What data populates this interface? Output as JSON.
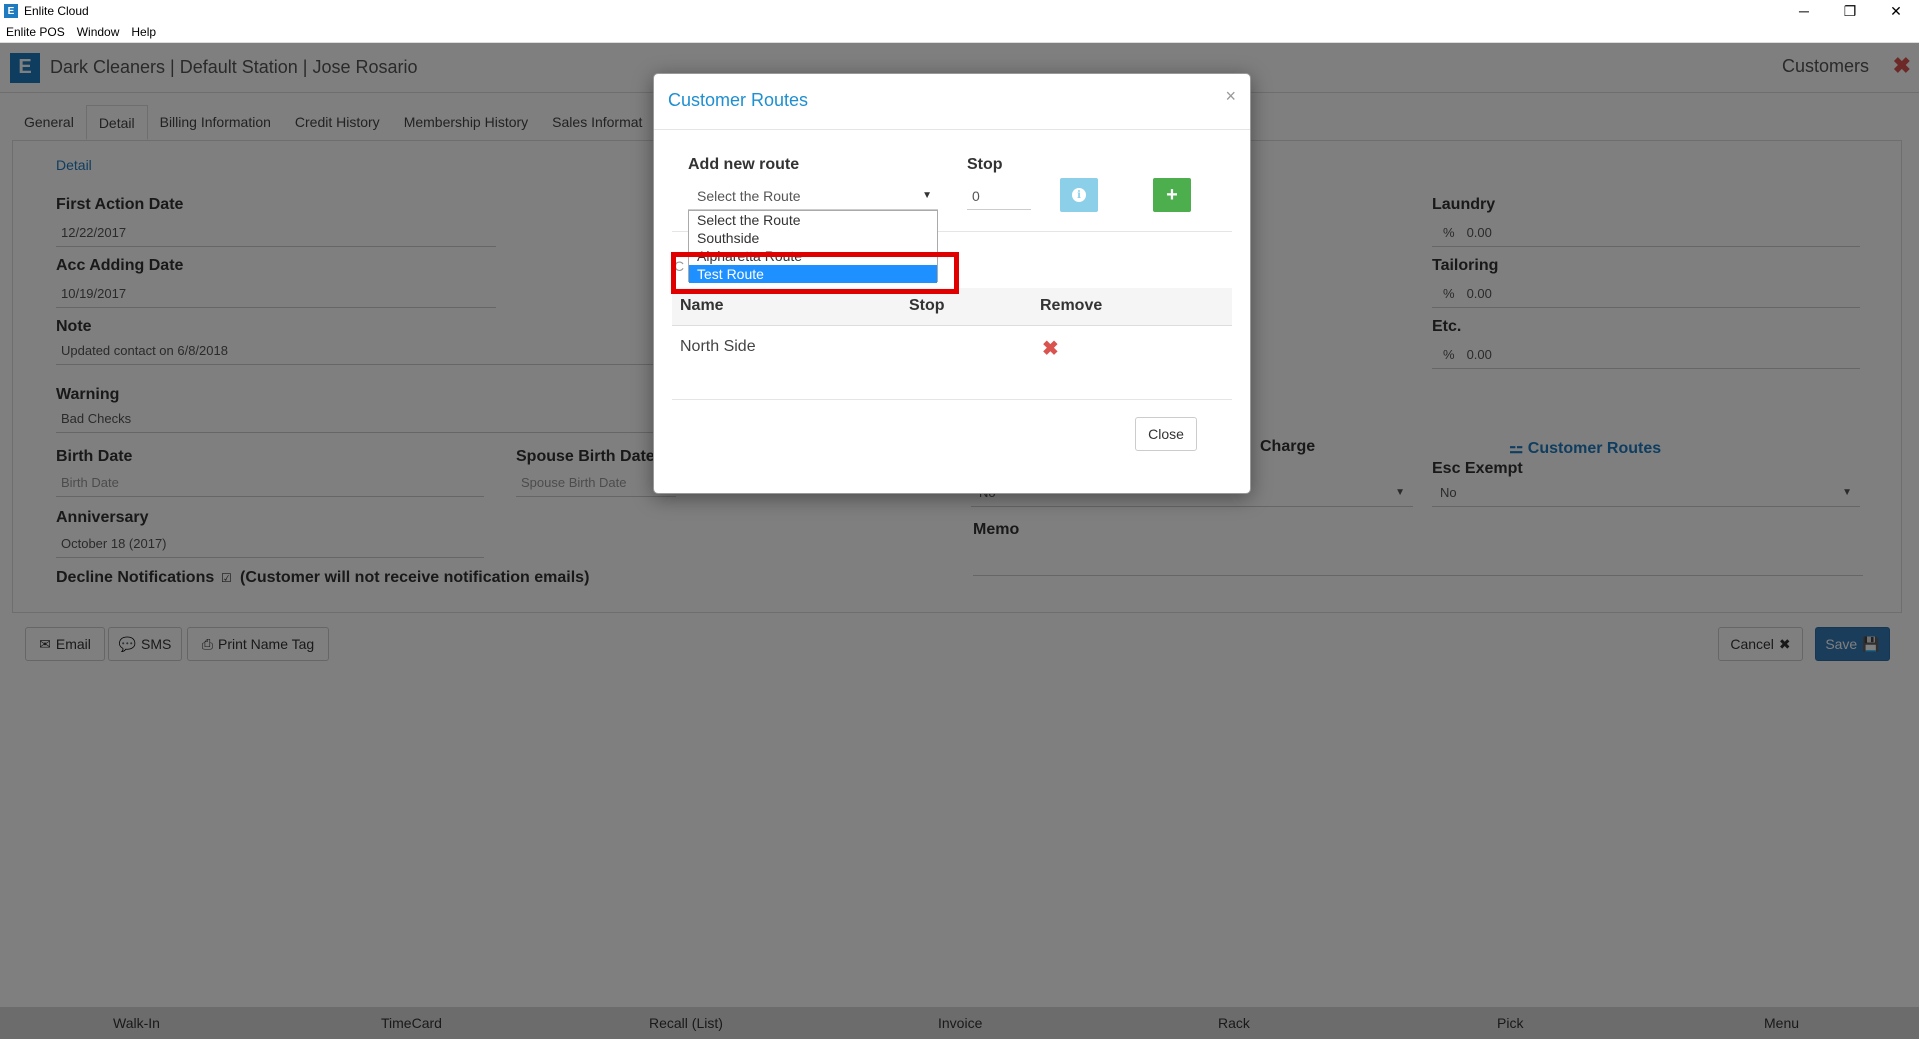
{
  "window": {
    "title": "Enlite Cloud",
    "controls": {
      "minimize": "─",
      "restore": "❐",
      "close": "✕"
    }
  },
  "menu": [
    "Enlite POS",
    "Window",
    "Help"
  ],
  "header": {
    "title": "Dark Cleaners | Default Station | Jose Rosario",
    "section": "Customers",
    "close": "✖"
  },
  "tabs": [
    "General",
    "Detail",
    "Billing Information",
    "Credit History",
    "Membership History",
    "Sales Informat"
  ],
  "detail": {
    "sub_link": "Detail",
    "first_action_label": "First Action Date",
    "first_action_value": "12/22/2017",
    "acc_adding_label": "Acc Adding Date",
    "acc_adding_value": "10/19/2017",
    "note_label": "Note",
    "note_value": "Updated contact on 6/8/2018",
    "warning_label": "Warning",
    "warning_value": "Bad Checks",
    "birth_label": "Birth Date",
    "birth_placeholder": "Birth Date",
    "spouse_label": "Spouse Birth Date",
    "spouse_placeholder": "Spouse Birth Date",
    "anniversary_label": "Anniversary",
    "anniversary_value": "October 18 (2017)",
    "decline_label": "Decline Notifications",
    "decline_note": "(Customer will not receive notification emails)",
    "laundry_label": "Laundry",
    "tailoring_label": "Tailoring",
    "etc_label": "Etc.",
    "percent": "%",
    "laundry_value": "0.00",
    "tailoring_value": "0.00",
    "etc_value": "0.00",
    "charge_label": "Charge",
    "customer_routes_link": "Customer Routes",
    "esc_exempt_label": "Esc Exempt",
    "charge_value": "No",
    "esc_exempt_value": "No",
    "memo_label": "Memo"
  },
  "actions": {
    "email": "Email",
    "sms": "SMS",
    "print_name_tag": "Print Name Tag",
    "cancel": "Cancel",
    "save": "Save"
  },
  "bottom_nav": [
    "Walk-In",
    "TimeCard",
    "Recall (List)",
    "Invoice",
    "Rack",
    "Pick",
    "Menu"
  ],
  "modal": {
    "title": "Customer Routes",
    "close_x": "×",
    "add_new_route_label": "Add new route",
    "stop_label": "Stop",
    "select_value": "Select the Route",
    "stop_value": "0",
    "options": [
      "Select the Route",
      "Southside",
      "Alpharetta Route",
      "Test Route"
    ],
    "selected_option": "Test Route",
    "partial_text": "C",
    "table_headers": [
      "Name",
      "Stop",
      "Remove"
    ],
    "rows": [
      {
        "name": "North Side",
        "stop": ""
      }
    ],
    "close_button": "Close"
  }
}
